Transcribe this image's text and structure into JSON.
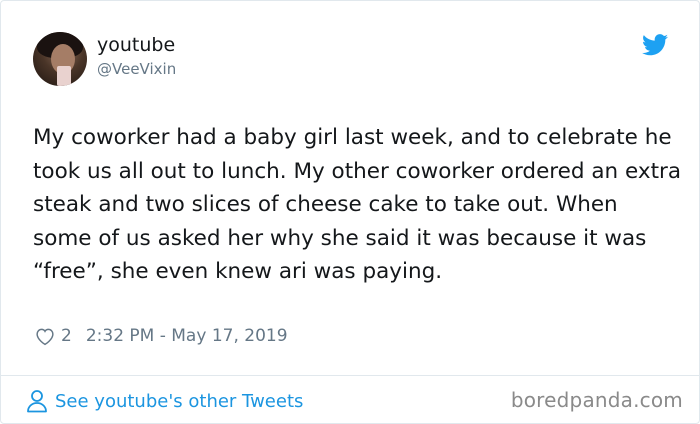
{
  "tweet": {
    "display_name": "youtube",
    "handle": "@VeeVixin",
    "text": "My coworker had a baby girl last week, and to celebrate he took us all out to lunch. My other coworker ordered an extra steak and two slices of cheese cake to take out. When some of us asked her why she said it was because it was “free”, she even knew ari was paying.",
    "likes": "2",
    "timestamp": "2:32 PM - May 17, 2019",
    "see_more": "See youtube's other Tweets"
  },
  "watermark": "boredpanda.com",
  "icons": {
    "brand": "twitter-bird-icon",
    "like": "heart-icon",
    "profile": "person-icon"
  },
  "colors": {
    "accent": "#1b95e0",
    "text": "#14171a",
    "muted": "#657786",
    "border": "#e1e8ed"
  }
}
